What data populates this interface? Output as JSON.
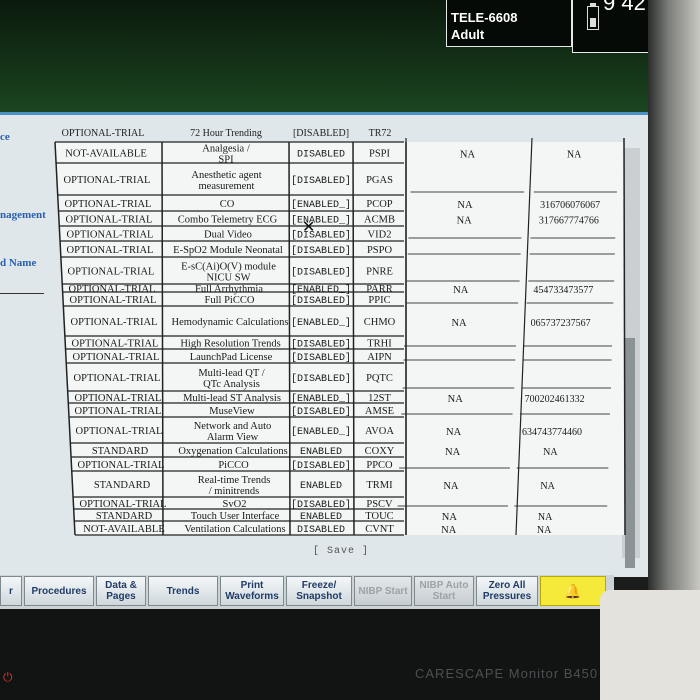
{
  "header": {
    "bed_label": "TELE-6608",
    "patient_type": "Adult",
    "clock": "9 42",
    "colors": {
      "screen_bg": "#1e4a23",
      "dialog_bg": "#dfe7ea",
      "accent": "#4d92c5",
      "alarm_button": "#f5ea3a"
    }
  },
  "side_labels": [
    "ce",
    "nagement",
    "d Name"
  ],
  "table": {
    "partial_top_row": {
      "status": "OPTIONAL-TRIAL",
      "name": "72 Hour Trending",
      "state": "[DISABLED]",
      "code": "TR72"
    },
    "rows": [
      {
        "status": "NOT-AVAILABLE",
        "name": "Analgesia / SPI",
        "state": "DISABLED",
        "code": "PSPI",
        "col5": "NA",
        "col6": "NA"
      },
      {
        "status": "OPTIONAL-TRIAL",
        "name": "Anesthetic agent measurement",
        "state": "[DISABLED]",
        "code": "PGAS",
        "col5": "",
        "col6": ""
      },
      {
        "status": "OPTIONAL-TRIAL",
        "name": "CO",
        "state": "[ENABLED_]",
        "code": "PCOP",
        "col5": "NA",
        "col6": "316706076067"
      },
      {
        "status": "OPTIONAL-TRIAL",
        "name": "Combo Telemetry ECG",
        "state": "[ENABLED_]",
        "code": "ACMB",
        "col5": "NA",
        "col6": "317667774766"
      },
      {
        "status": "OPTIONAL-TRIAL",
        "name": "Dual Video",
        "state": "[DISABLED]",
        "code": "VID2",
        "col5": "",
        "col6": ""
      },
      {
        "status": "OPTIONAL-TRIAL",
        "name": "E-SpO2 Module Neonatal",
        "state": "[DISABLED]",
        "code": "PSPO",
        "col5": "",
        "col6": ""
      },
      {
        "status": "OPTIONAL-TRIAL",
        "name": "E-sC(Ai)O(V) module NICU SW",
        "state": "[DISABLED]",
        "code": "PNRE",
        "col5": "",
        "col6": ""
      },
      {
        "status": "OPTIONAL-TRIAL",
        "name": "Full Arrhythmia",
        "state": "[ENABLED_]",
        "code": "PARR",
        "col5": "NA",
        "col6": "454733473577"
      },
      {
        "status": "OPTIONAL-TRIAL",
        "name": "Full PiCCO",
        "state": "[DISABLED]",
        "code": "PPIC",
        "col5": "",
        "col6": ""
      },
      {
        "status": "OPTIONAL-TRIAL",
        "name": "Hemodynamic Calculations",
        "state": "[ENABLED_]",
        "code": "CHMO",
        "col5": "NA",
        "col6": "065737237567"
      },
      {
        "status": "OPTIONAL-TRIAL",
        "name": "High Resolution Trends",
        "state": "[DISABLED]",
        "code": "TRHI",
        "col5": "",
        "col6": ""
      },
      {
        "status": "OPTIONAL-TRIAL",
        "name": "LaunchPad License",
        "state": "[DISABLED]",
        "code": "AIPN",
        "col5": "",
        "col6": ""
      },
      {
        "status": "OPTIONAL-TRIAL",
        "name": "Multi-lead QT / QTc Analysis",
        "state": "[DISABLED]",
        "code": "PQTC",
        "col5": "",
        "col6": ""
      },
      {
        "status": "OPTIONAL-TRIAL",
        "name": "Multi-lead ST Analysis",
        "state": "[ENABLED_]",
        "code": "12ST",
        "col5": "NA",
        "col6": "700202461332"
      },
      {
        "status": "OPTIONAL-TRIAL",
        "name": "MuseView",
        "state": "[DISABLED]",
        "code": "AMSE",
        "col5": "",
        "col6": ""
      },
      {
        "status": "OPTIONAL-TRIAL",
        "name": "Network and Auto Alarm View",
        "state": "[ENABLED_]",
        "code": "AVOA",
        "col5": "NA",
        "col6": "634743774460"
      },
      {
        "status": "STANDARD",
        "name": "Oxygenation Calculations",
        "state": "ENABLED",
        "code": "COXY",
        "col5": "NA",
        "col6": "NA"
      },
      {
        "status": "OPTIONAL-TRIAL",
        "name": "PiCCO",
        "state": "[DISABLED]",
        "code": "PPCO",
        "col5": "",
        "col6": ""
      },
      {
        "status": "STANDARD",
        "name": "Real-time Trends / minitrends",
        "state": "ENABLED",
        "code": "TRMI",
        "col5": "NA",
        "col6": "NA"
      },
      {
        "status": "OPTIONAL-TRIAL",
        "name": "SvO2",
        "state": "[DISABLED]",
        "code": "PSCV",
        "col5": "",
        "col6": ""
      },
      {
        "status": "STANDARD",
        "name": "Touch User Interface",
        "state": "ENABLED",
        "code": "TOUC",
        "col5": "NA",
        "col6": "NA"
      },
      {
        "status": "NOT-AVAILABLE",
        "name": "Ventilation Calculations",
        "state": "DISABLED",
        "code": "CVNT",
        "col5": "NA",
        "col6": "NA"
      }
    ]
  },
  "dialog": {
    "save_label": "[ Save ]"
  },
  "toolbar": [
    {
      "label": "r",
      "enabled": true
    },
    {
      "label": "Procedures",
      "enabled": true
    },
    {
      "label": "Data & Pages",
      "enabled": true
    },
    {
      "label": "Trends",
      "enabled": true
    },
    {
      "label": "Print Waveforms",
      "enabled": true
    },
    {
      "label": "Freeze/ Snapshot",
      "enabled": true
    },
    {
      "label": "NIBP Start",
      "enabled": false
    },
    {
      "label": "NIBP Auto Start",
      "enabled": false
    },
    {
      "label": "Zero All Pressures",
      "enabled": true
    },
    {
      "label": "",
      "enabled": true,
      "icon": "alarm-bell-icon"
    }
  ],
  "device": {
    "brand": "CARESCAPE Monitor B450",
    "power_icon": "power-icon"
  }
}
